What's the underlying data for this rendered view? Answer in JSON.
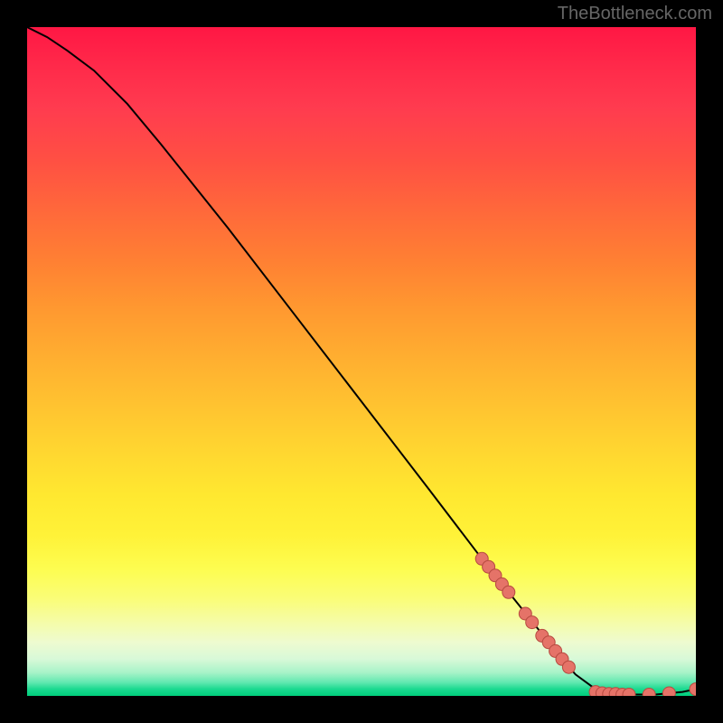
{
  "attribution": "TheBottleneck.com",
  "chart_data": {
    "type": "line",
    "title": "",
    "xlabel": "",
    "ylabel": "",
    "xlim": [
      0,
      100
    ],
    "ylim": [
      0,
      100
    ],
    "grid": false,
    "legend": false,
    "series": [
      {
        "name": "bottleneck-curve",
        "x": [
          0,
          3,
          6,
          10,
          15,
          20,
          30,
          40,
          50,
          60,
          68,
          70,
          72,
          74,
          76,
          78,
          80,
          82,
          85,
          88,
          90,
          92,
          94,
          96,
          98,
          100
        ],
        "y": [
          100,
          98.5,
          96.5,
          93.5,
          88.5,
          82.5,
          70,
          57,
          44,
          31,
          20.5,
          18,
          15.5,
          13,
          10.5,
          8,
          5.5,
          3.2,
          1,
          0.3,
          0.2,
          0.2,
          0.2,
          0.4,
          0.6,
          1
        ]
      }
    ],
    "markers": {
      "name": "highlighted-points",
      "points": [
        {
          "x": 68,
          "y": 20.5
        },
        {
          "x": 69,
          "y": 19.3
        },
        {
          "x": 70,
          "y": 18
        },
        {
          "x": 71,
          "y": 16.7
        },
        {
          "x": 72,
          "y": 15.5
        },
        {
          "x": 74.5,
          "y": 12.3
        },
        {
          "x": 75.5,
          "y": 11
        },
        {
          "x": 77,
          "y": 9
        },
        {
          "x": 78,
          "y": 8
        },
        {
          "x": 79,
          "y": 6.7
        },
        {
          "x": 80,
          "y": 5.5
        },
        {
          "x": 81,
          "y": 4.3
        },
        {
          "x": 85,
          "y": 0.6
        },
        {
          "x": 86,
          "y": 0.4
        },
        {
          "x": 87,
          "y": 0.3
        },
        {
          "x": 88,
          "y": 0.3
        },
        {
          "x": 89,
          "y": 0.2
        },
        {
          "x": 90,
          "y": 0.2
        },
        {
          "x": 93,
          "y": 0.2
        },
        {
          "x": 96,
          "y": 0.4
        },
        {
          "x": 100,
          "y": 1
        }
      ]
    },
    "background": "vertical-gradient red→yellow→green"
  }
}
